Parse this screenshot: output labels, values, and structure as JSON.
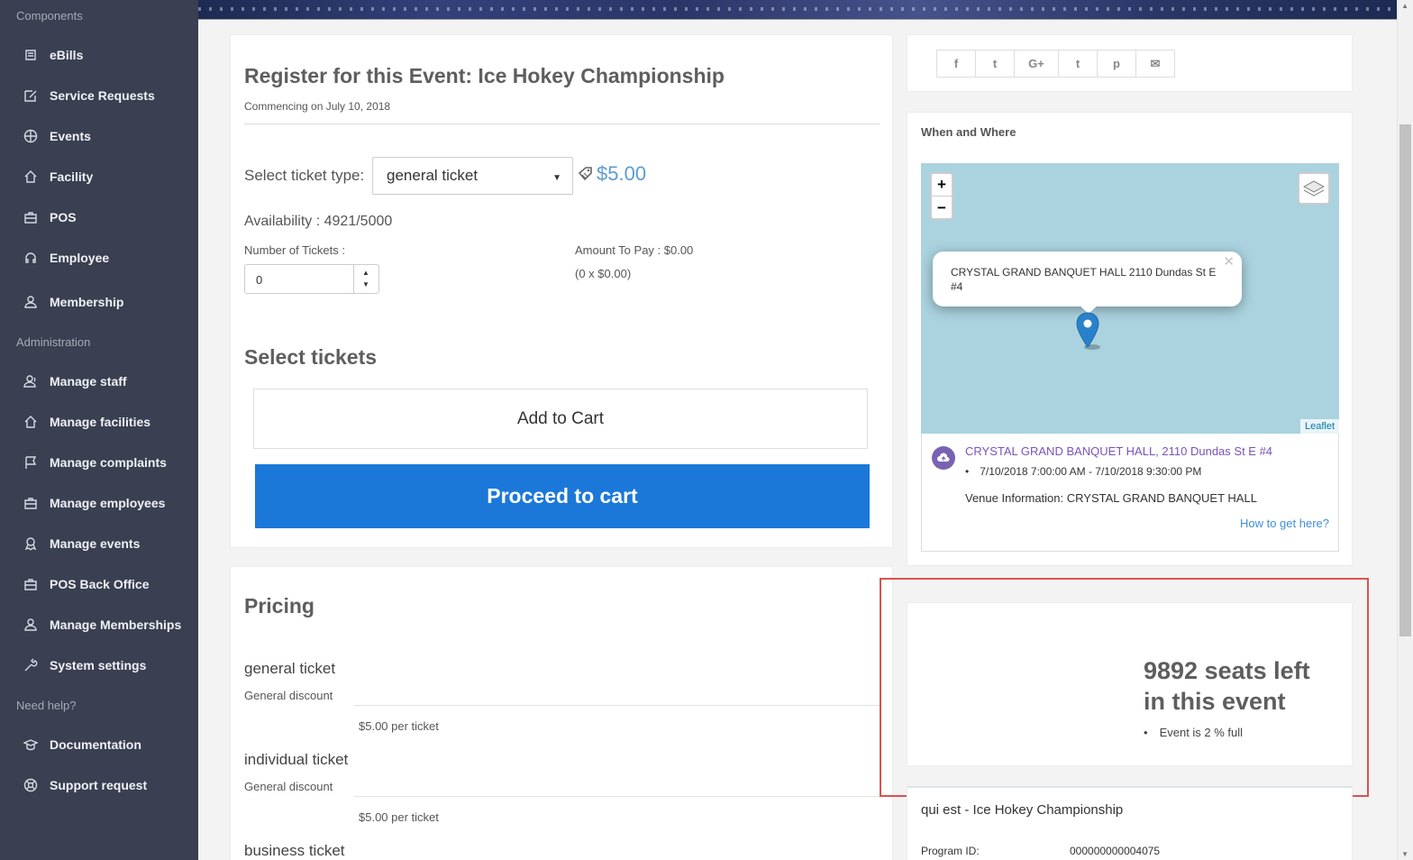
{
  "sidebar": {
    "sections": [
      "Components",
      "Administration",
      "Need help?"
    ],
    "items": [
      {
        "label": "eBills",
        "icon": "bill-icon"
      },
      {
        "label": "Service Requests",
        "icon": "edit-icon"
      },
      {
        "label": "Events",
        "icon": "basketball-icon"
      },
      {
        "label": "Facility",
        "icon": "home-icon"
      },
      {
        "label": "POS",
        "icon": "register-icon"
      },
      {
        "label": "Employee",
        "icon": "headset-icon"
      },
      {
        "label": "Membership",
        "icon": "user-icon"
      },
      {
        "label": "Manage staff",
        "icon": "user-group-icon"
      },
      {
        "label": "Manage facilities",
        "icon": "home-icon"
      },
      {
        "label": "Manage complaints",
        "icon": "flag-icon"
      },
      {
        "label": "Manage employees",
        "icon": "briefcase-icon"
      },
      {
        "label": "Manage events",
        "icon": "award-icon"
      },
      {
        "label": "POS Back Office",
        "icon": "register-icon"
      },
      {
        "label": "Manage Memberships",
        "icon": "user-icon"
      },
      {
        "label": "System settings",
        "icon": "wrench-icon"
      },
      {
        "label": "Documentation",
        "icon": "graduation-icon"
      },
      {
        "label": "Support request",
        "icon": "lifebuoy-icon"
      }
    ]
  },
  "register": {
    "title": "Register for this Event: Ice Hokey Championship",
    "subtitle": "Commencing on July 10, 2018",
    "ticket_type_label": "Select ticket type:",
    "ticket_type_value": "general ticket",
    "price": "$5.00",
    "availability": "Availability : 4921/5000",
    "num_tickets_label": "Number of Tickets :",
    "num_tickets_value": "0",
    "amount_to_pay": "Amount To Pay : $0.00",
    "amount_detail": "(0 x $0.00)",
    "select_tickets": "Select tickets",
    "add_to_cart": "Add to Cart",
    "proceed": "Proceed to cart"
  },
  "pricing": {
    "title": "Pricing",
    "tickets": [
      {
        "name": "general ticket",
        "discount": "General discount",
        "price": "$5.00 per ticket"
      },
      {
        "name": "individual ticket",
        "discount": "General discount",
        "price": "$5.00 per ticket"
      },
      {
        "name": "business ticket"
      }
    ]
  },
  "share": {
    "buttons": [
      {
        "label": "f",
        "icon": "facebook-icon"
      },
      {
        "label": "t",
        "icon": "twitter-icon"
      },
      {
        "label": "G+",
        "icon": "google-plus-icon"
      },
      {
        "label": "t",
        "icon": "tumblr-icon"
      },
      {
        "label": "p",
        "icon": "pinterest-icon"
      },
      {
        "label": "✉",
        "icon": "email-icon"
      }
    ]
  },
  "where": {
    "title": "When and Where",
    "popup": "CRYSTAL GRAND BANQUET HALL 2110 Dundas St E #4",
    "attribution": "Leaflet",
    "venue_name": "CRYSTAL GRAND BANQUET HALL, 2110 Dundas St E #4",
    "time": "7/10/2018 7:00:00 AM - 7/10/2018 9:30:00 PM",
    "venue_info": "Venue Information: CRYSTAL GRAND BANQUET HALL",
    "directions": "How to get here?"
  },
  "seats": {
    "line1": "9892 seats left",
    "line2": "in this event",
    "full": "Event is 2 % full"
  },
  "program": {
    "title": "qui est - Ice Hokey Championship",
    "id_label": "Program ID:",
    "id_value": "000000000004075"
  },
  "colors": {
    "sidebar_bg": "#3a3f51",
    "primary_button": "#1b78d8",
    "price": "#5b9bd5",
    "highlight_border": "#d9534f",
    "venue_link": "#7a53b8"
  }
}
